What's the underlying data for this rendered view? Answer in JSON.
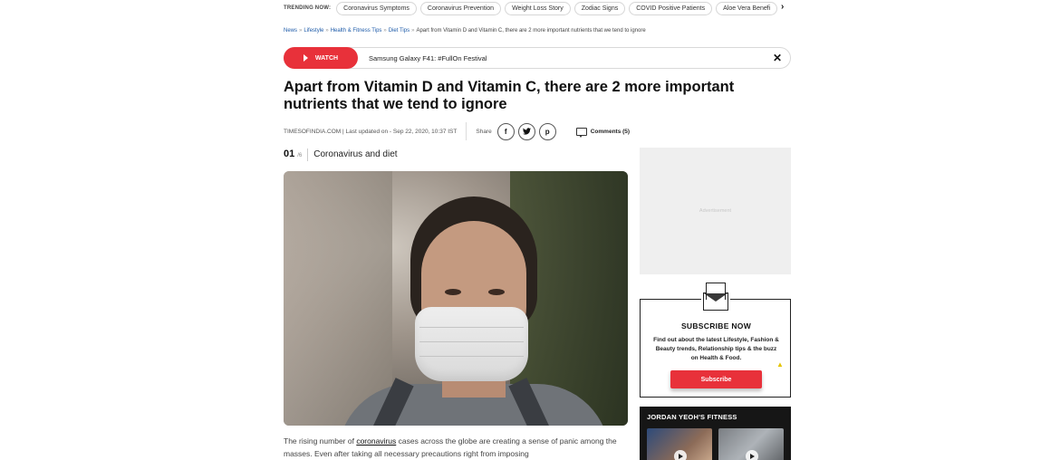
{
  "trending": {
    "label": "TRENDING NOW:",
    "items": [
      "Coronavirus Symptoms",
      "Coronavirus Prevention",
      "Weight Loss Story",
      "Zodiac Signs",
      "COVID Positive Patients",
      "Aloe Vera Benefi"
    ],
    "prev_icon": "chevron-left-icon",
    "next_icon": "chevron-right-icon"
  },
  "breadcrumb": {
    "items": [
      "News",
      "Lifestyle",
      "Health & Fitness Tips",
      "Diet Tips"
    ],
    "current": "Apart from Vitamin D and Vitamin C, there are 2 more important nutrients that we tend to ignore"
  },
  "watchbar": {
    "button_label": "WATCH",
    "title": "Samsung Galaxy F41: #FullOn Festival",
    "close_icon": "close-icon",
    "accent_color": "#e8313a"
  },
  "article": {
    "headline": "Apart from Vitamin D and Vitamin C, there are 2 more important nutrients that we tend to ignore",
    "byline": "TIMESOFINDIA.COM | Last updated on - Sep 22, 2020, 10:37 IST",
    "share_label": "Share",
    "share_icons": [
      "facebook-icon",
      "twitter-icon",
      "pinterest-icon"
    ],
    "comments_label": "Comments (5)"
  },
  "slide": {
    "number": "01",
    "total": "/6",
    "title": "Coronavirus and diet"
  },
  "body": {
    "text_before": "The rising number of ",
    "link": "coronavirus",
    "text_after": " cases across the globe are creating a sense of panic among the masses. Even after taking all necessary precautions right from imposing"
  },
  "rail": {
    "ad_label": "Advertisement",
    "subscribe": {
      "title": "SUBSCRIBE NOW",
      "description": "Find out about the latest Lifestyle, Fashion & Beauty trends, Relationship tips & the buzz on Health & Food.",
      "button_label": "Subscribe"
    },
    "fitness": {
      "title": "JORDAN YEOH'S FITNESS"
    }
  }
}
